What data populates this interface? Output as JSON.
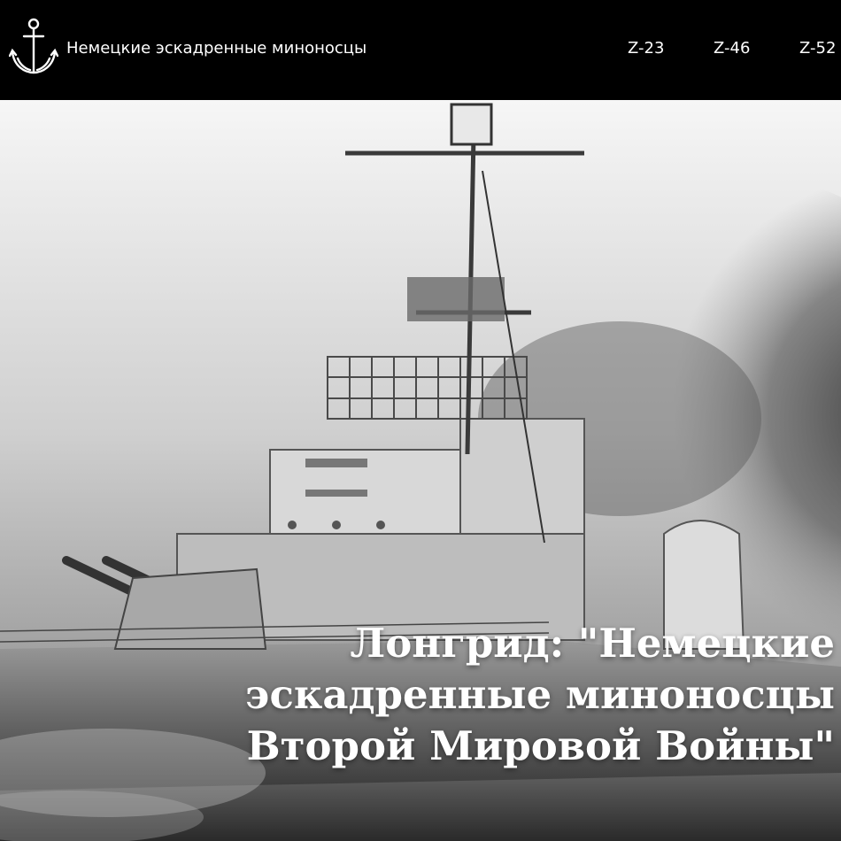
{
  "header": {
    "logo_icon": "anchor-icon",
    "site_title": "Немецкие эскадренные миноносцы",
    "nav": [
      {
        "label": "Z-23"
      },
      {
        "label": "Z-46"
      },
      {
        "label": "Z-52"
      }
    ]
  },
  "hero": {
    "image": "destroyer-photo",
    "headline_lines": [
      "Лонгрид: \"Немецкие",
      "эскадренные миноносцы",
      "Второй Мировой Войны\""
    ]
  },
  "colors": {
    "header_bg": "#000000",
    "text": "#ffffff"
  }
}
